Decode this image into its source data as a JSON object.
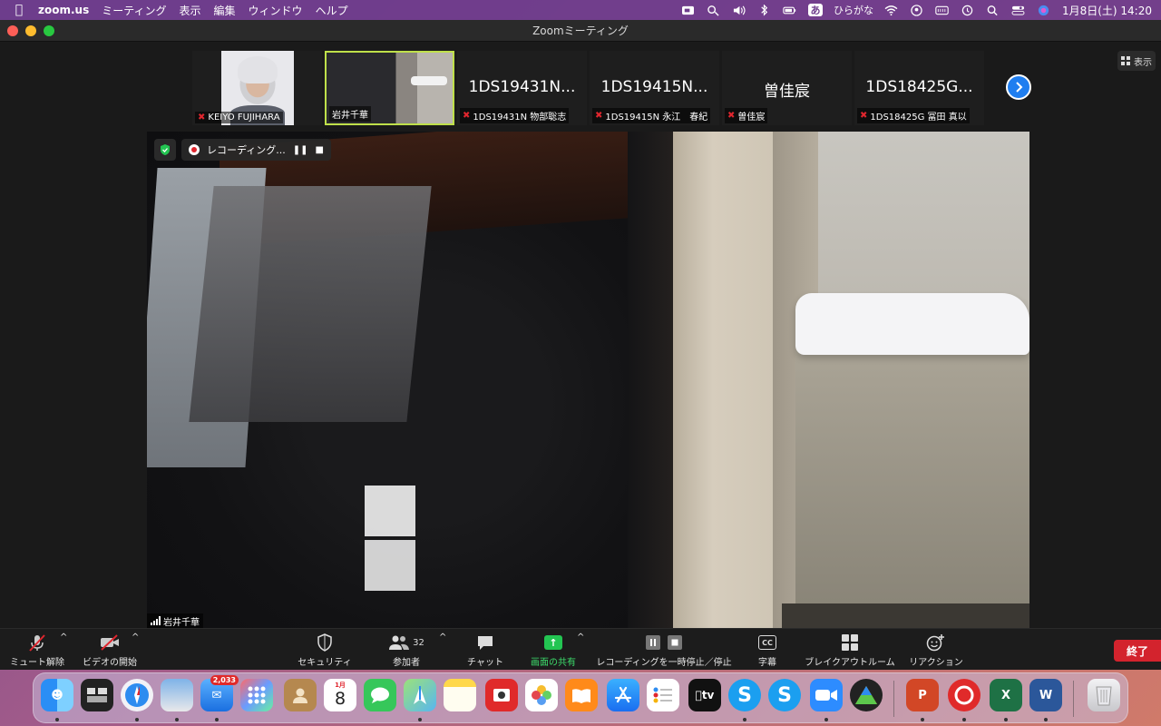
{
  "menubar": {
    "app_name": "zoom.us",
    "menus": [
      "ミーティング",
      "表示",
      "編集",
      "ウィンドウ",
      "ヘルプ"
    ],
    "input_method": "あ",
    "input_method_label": "ひらがな",
    "datetime": "1月8日(土)  14:20"
  },
  "window": {
    "title": "Zoomミーティング",
    "view_label": "表示"
  },
  "participants": [
    {
      "big_text": "",
      "name": "KEIYO FUJIHARA",
      "muted": true,
      "kind": "face"
    },
    {
      "big_text": "",
      "name": "岩井千華",
      "muted": false,
      "kind": "scene",
      "active": true
    },
    {
      "big_text": "1DS19431N...",
      "name": "1DS19431N 物部聡志",
      "muted": true
    },
    {
      "big_text": "1DS19415N...",
      "name": "1DS19415N 永江　春紀",
      "muted": true
    },
    {
      "big_text": "曽佳宸",
      "name": "曽佳宸",
      "muted": true
    },
    {
      "big_text": "1DS18425G...",
      "name": "1DS18425G 冨田 真以",
      "muted": true
    }
  ],
  "main_video": {
    "recording_label": "レコーディング...",
    "speaker_name": "岩井千華"
  },
  "toolbar": {
    "mute_label": "ミュート解除",
    "video_label": "ビデオの開始",
    "security_label": "セキュリティ",
    "participants_label": "参加者",
    "participants_count": "32",
    "chat_label": "チャット",
    "share_label": "画面の共有",
    "recording_label": "レコーディングを一時停止／停止",
    "cc_label": "字幕",
    "cc_icon": "CC",
    "breakout_label": "ブレイクアウトルーム",
    "reaction_label": "リアクション",
    "end_label": "終了"
  },
  "dock": {
    "mail_badge": "2,033",
    "calendar_month": "1月",
    "calendar_day": "8",
    "tv_label": "tv"
  },
  "colors": {
    "share_green": "#23c552",
    "end_red": "#d3232d",
    "active_border": "#bfe04a",
    "next_blue": "#1f7ef0"
  }
}
